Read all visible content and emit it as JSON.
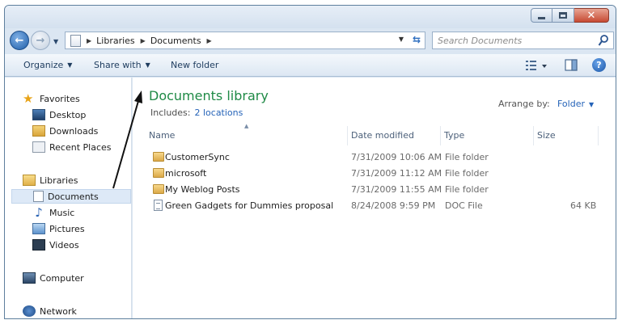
{
  "address": {
    "crumbs": [
      "Libraries",
      "Documents"
    ],
    "search_placeholder": "Search Documents"
  },
  "toolbar": {
    "organize": "Organize",
    "share_with": "Share with",
    "new_folder": "New folder"
  },
  "nav": {
    "favorites": "Favorites",
    "desktop": "Desktop",
    "downloads": "Downloads",
    "recent_places": "Recent Places",
    "libraries": "Libraries",
    "documents": "Documents",
    "music": "Music",
    "pictures": "Pictures",
    "videos": "Videos",
    "computer": "Computer",
    "network": "Network"
  },
  "library": {
    "title": "Documents library",
    "includes_label": "Includes:",
    "includes_link": "2 locations",
    "arrange_label": "Arrange by:",
    "arrange_value": "Folder"
  },
  "columns": {
    "name": "Name",
    "date": "Date modified",
    "type": "Type",
    "size": "Size"
  },
  "files": [
    {
      "name": "CustomerSync",
      "date": "7/31/2009 10:06 AM",
      "type": "File folder",
      "size": ""
    },
    {
      "name": "microsoft",
      "date": "7/31/2009 11:12 AM",
      "type": "File folder",
      "size": ""
    },
    {
      "name": "My Weblog Posts",
      "date": "7/31/2009 11:55 AM",
      "type": "File folder",
      "size": ""
    },
    {
      "name": "Green Gadgets for Dummies proposal",
      "date": "8/24/2008 9:59 PM",
      "type": "DOC File",
      "size": "64 KB"
    }
  ]
}
